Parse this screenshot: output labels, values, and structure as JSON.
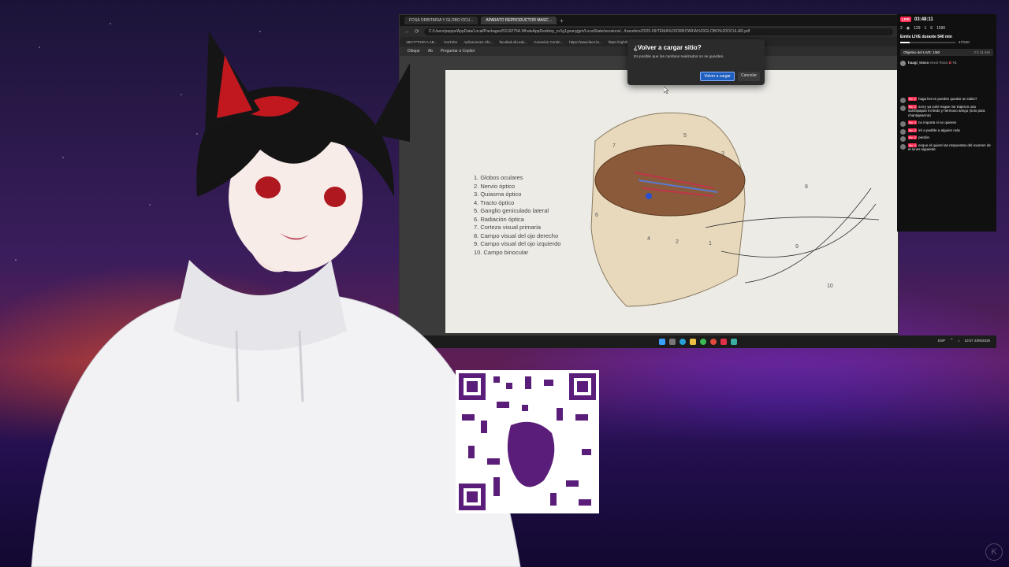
{
  "browser": {
    "tabs": [
      {
        "label": "FOSA ORBITARIA Y GLOBO OCU...",
        "active": false
      },
      {
        "label": "APARATO REPRODUCTOR MASC...",
        "active": true
      }
    ],
    "url": "C:/Users/pepps/AppData/Local/Packages/5319275A.WhatsAppDesktop_cv1g1gvanyjgm/LocalState/sessions/.../transfers/2025-09/TEMA%20ORBITARIA%20GLOBO%20OCULAR.pdf",
    "bookmarks": [
      "1BCT7TXDV LAB...",
      "YouTube",
      "Aplicaciones Ufu...",
      "facultad.ufu.edu...",
      "Conexión Contin...",
      "https://www.face.la...",
      "https://rightfm.la..."
    ],
    "pdf_toolbar": [
      "Dibujar",
      "Ab",
      "Preguntar a Copilot"
    ],
    "legend": [
      "1.   Globos oculares",
      "2.   Nervio óptico",
      "3.   Quiasma óptico",
      "4.   Tracto óptico",
      "5.   Ganglio geniculado lateral",
      "6.   Radiación óptica",
      "7.   Corteza visual primaria",
      "8.   Campo visual del ojo derecho",
      "9.   Campo visual del ojo izquierdo",
      "10.  Campo binocular"
    ],
    "figure_labels": [
      "1",
      "2",
      "3",
      "4",
      "5",
      "6",
      "7",
      "8",
      "9",
      "10"
    ]
  },
  "dialog": {
    "title": "¿Volver a cargar sitio?",
    "text": "Es posible que los cambios realizados no se guarden.",
    "primary": "Volver a cargar",
    "secondary": "Cancelar"
  },
  "taskbar": {
    "tray_time": "10:07",
    "tray_date": "2/09/2025",
    "tray_lang": "ESP",
    "weather_label": "31°C"
  },
  "overlay": {
    "live": "LIVE",
    "time": "03:48:11",
    "stats": [
      "2",
      "129",
      "1",
      "6",
      "1590"
    ],
    "goal_title": "Emite LIVE durante 540 min",
    "goal_progress": 0.17,
    "goal_count": "47/240",
    "pinned_text": "Objetivo del LIVE: 1/50",
    "pinned_meta": "2 h 11 min",
    "gift_user": "haagi_tnsco",
    "gift_text": "envió Rosa",
    "gift_count": "×1",
    "messages": [
      {
        "user": "",
        "badge": "Nv. 2",
        "text": "haga live te puedes quedar un ratito?"
      },
      {
        "user": "",
        "badge": "Nv. 1",
        "text": "sorry ya volví esque me trajeron una salchipapas mi lindo y hermoso amigo (solo para chantajearme)"
      },
      {
        "user": "",
        "badge": "Nv. 2",
        "text": "no importa si no quieres"
      },
      {
        "user": "",
        "badge": "Nv. 2",
        "text": "iré a pedirle a alguien más"
      },
      {
        "user": "",
        "badge": "Nv. 2",
        "text": "perdón"
      },
      {
        "user": "",
        "badge": "Nv. 1",
        "text": "esque el quiere las respuestas del examen de el lunes siguiente"
      }
    ]
  },
  "colors": {
    "accent": "#1f5fbf",
    "live": "#ff2d55",
    "qr": "#5a1d7a"
  },
  "icons": [
    "back-icon",
    "reload-icon",
    "draw-icon",
    "search-icon",
    "file-explorer-icon",
    "chrome-icon",
    "edge-icon",
    "tiktok-icon",
    "wifi-icon",
    "volume-icon"
  ]
}
